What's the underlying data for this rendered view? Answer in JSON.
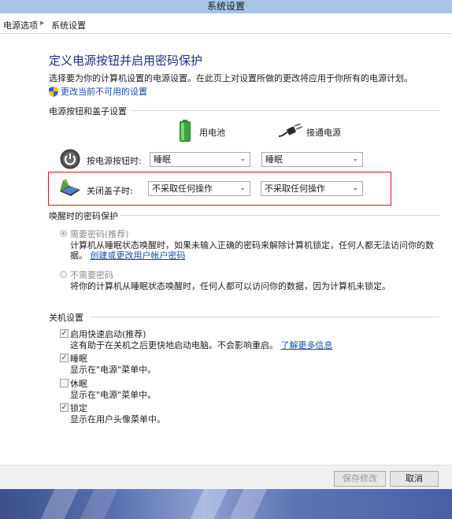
{
  "window": {
    "title": "系统设置"
  },
  "breadcrumb": {
    "parent": "电源选项",
    "current": "系统设置"
  },
  "page": {
    "heading": "定义电源按钮并启用密码保护",
    "description": "选择要为你的计算机设置的电源设置。在此页上对设置所做的更改将应用于你所有的电源计划。",
    "change_link": "更改当前不可用的设置"
  },
  "power_section": {
    "title": "电源按钮和盖子设置",
    "col_battery": "用电池",
    "col_plugged": "接通电源",
    "rows": [
      {
        "label": "按电源按钮时:",
        "battery": "睡眠",
        "plugged": "睡眠"
      },
      {
        "label": "关闭盖子时:",
        "battery": "不采取任何操作",
        "plugged": "不采取任何操作"
      }
    ]
  },
  "wake_section": {
    "title": "唤醒时的密码保护",
    "option1_title": "需要密码(推荐)",
    "option1_desc_line1": "计算机从睡眠状态唤醒时，如果未输入正确的密码来解除计算机锁定，任何人都无法访问你的数",
    "option1_desc_line2": "据。",
    "option1_link": "创建或更改用户帐户密码",
    "option2_title": "不需要密码",
    "option2_desc": "将你的计算机从睡眠状态唤醒时，任何人都可以访问你的数据，因为计算机未锁定。"
  },
  "shutdown_section": {
    "title": "关机设置",
    "items": [
      {
        "label": "启用快速启动(推荐)",
        "desc": "这有助于在关机之后更快地启动电脑。不会影响重启。",
        "link": "了解更多信息",
        "checked": true
      },
      {
        "label": "睡眠",
        "desc": "显示在\"电源\"菜单中。",
        "checked": true
      },
      {
        "label": "休眠",
        "desc": "显示在\"电源\"菜单中。",
        "checked": false
      },
      {
        "label": "锁定",
        "desc": "显示在用户头像菜单中。",
        "checked": true
      }
    ]
  },
  "footer": {
    "save": "保存修改",
    "cancel": "取消"
  },
  "colors": {
    "title_bar": "#a6c4e8",
    "heading": "#1e3287",
    "link": "#1a4ca8",
    "highlight": "#d0181d"
  }
}
